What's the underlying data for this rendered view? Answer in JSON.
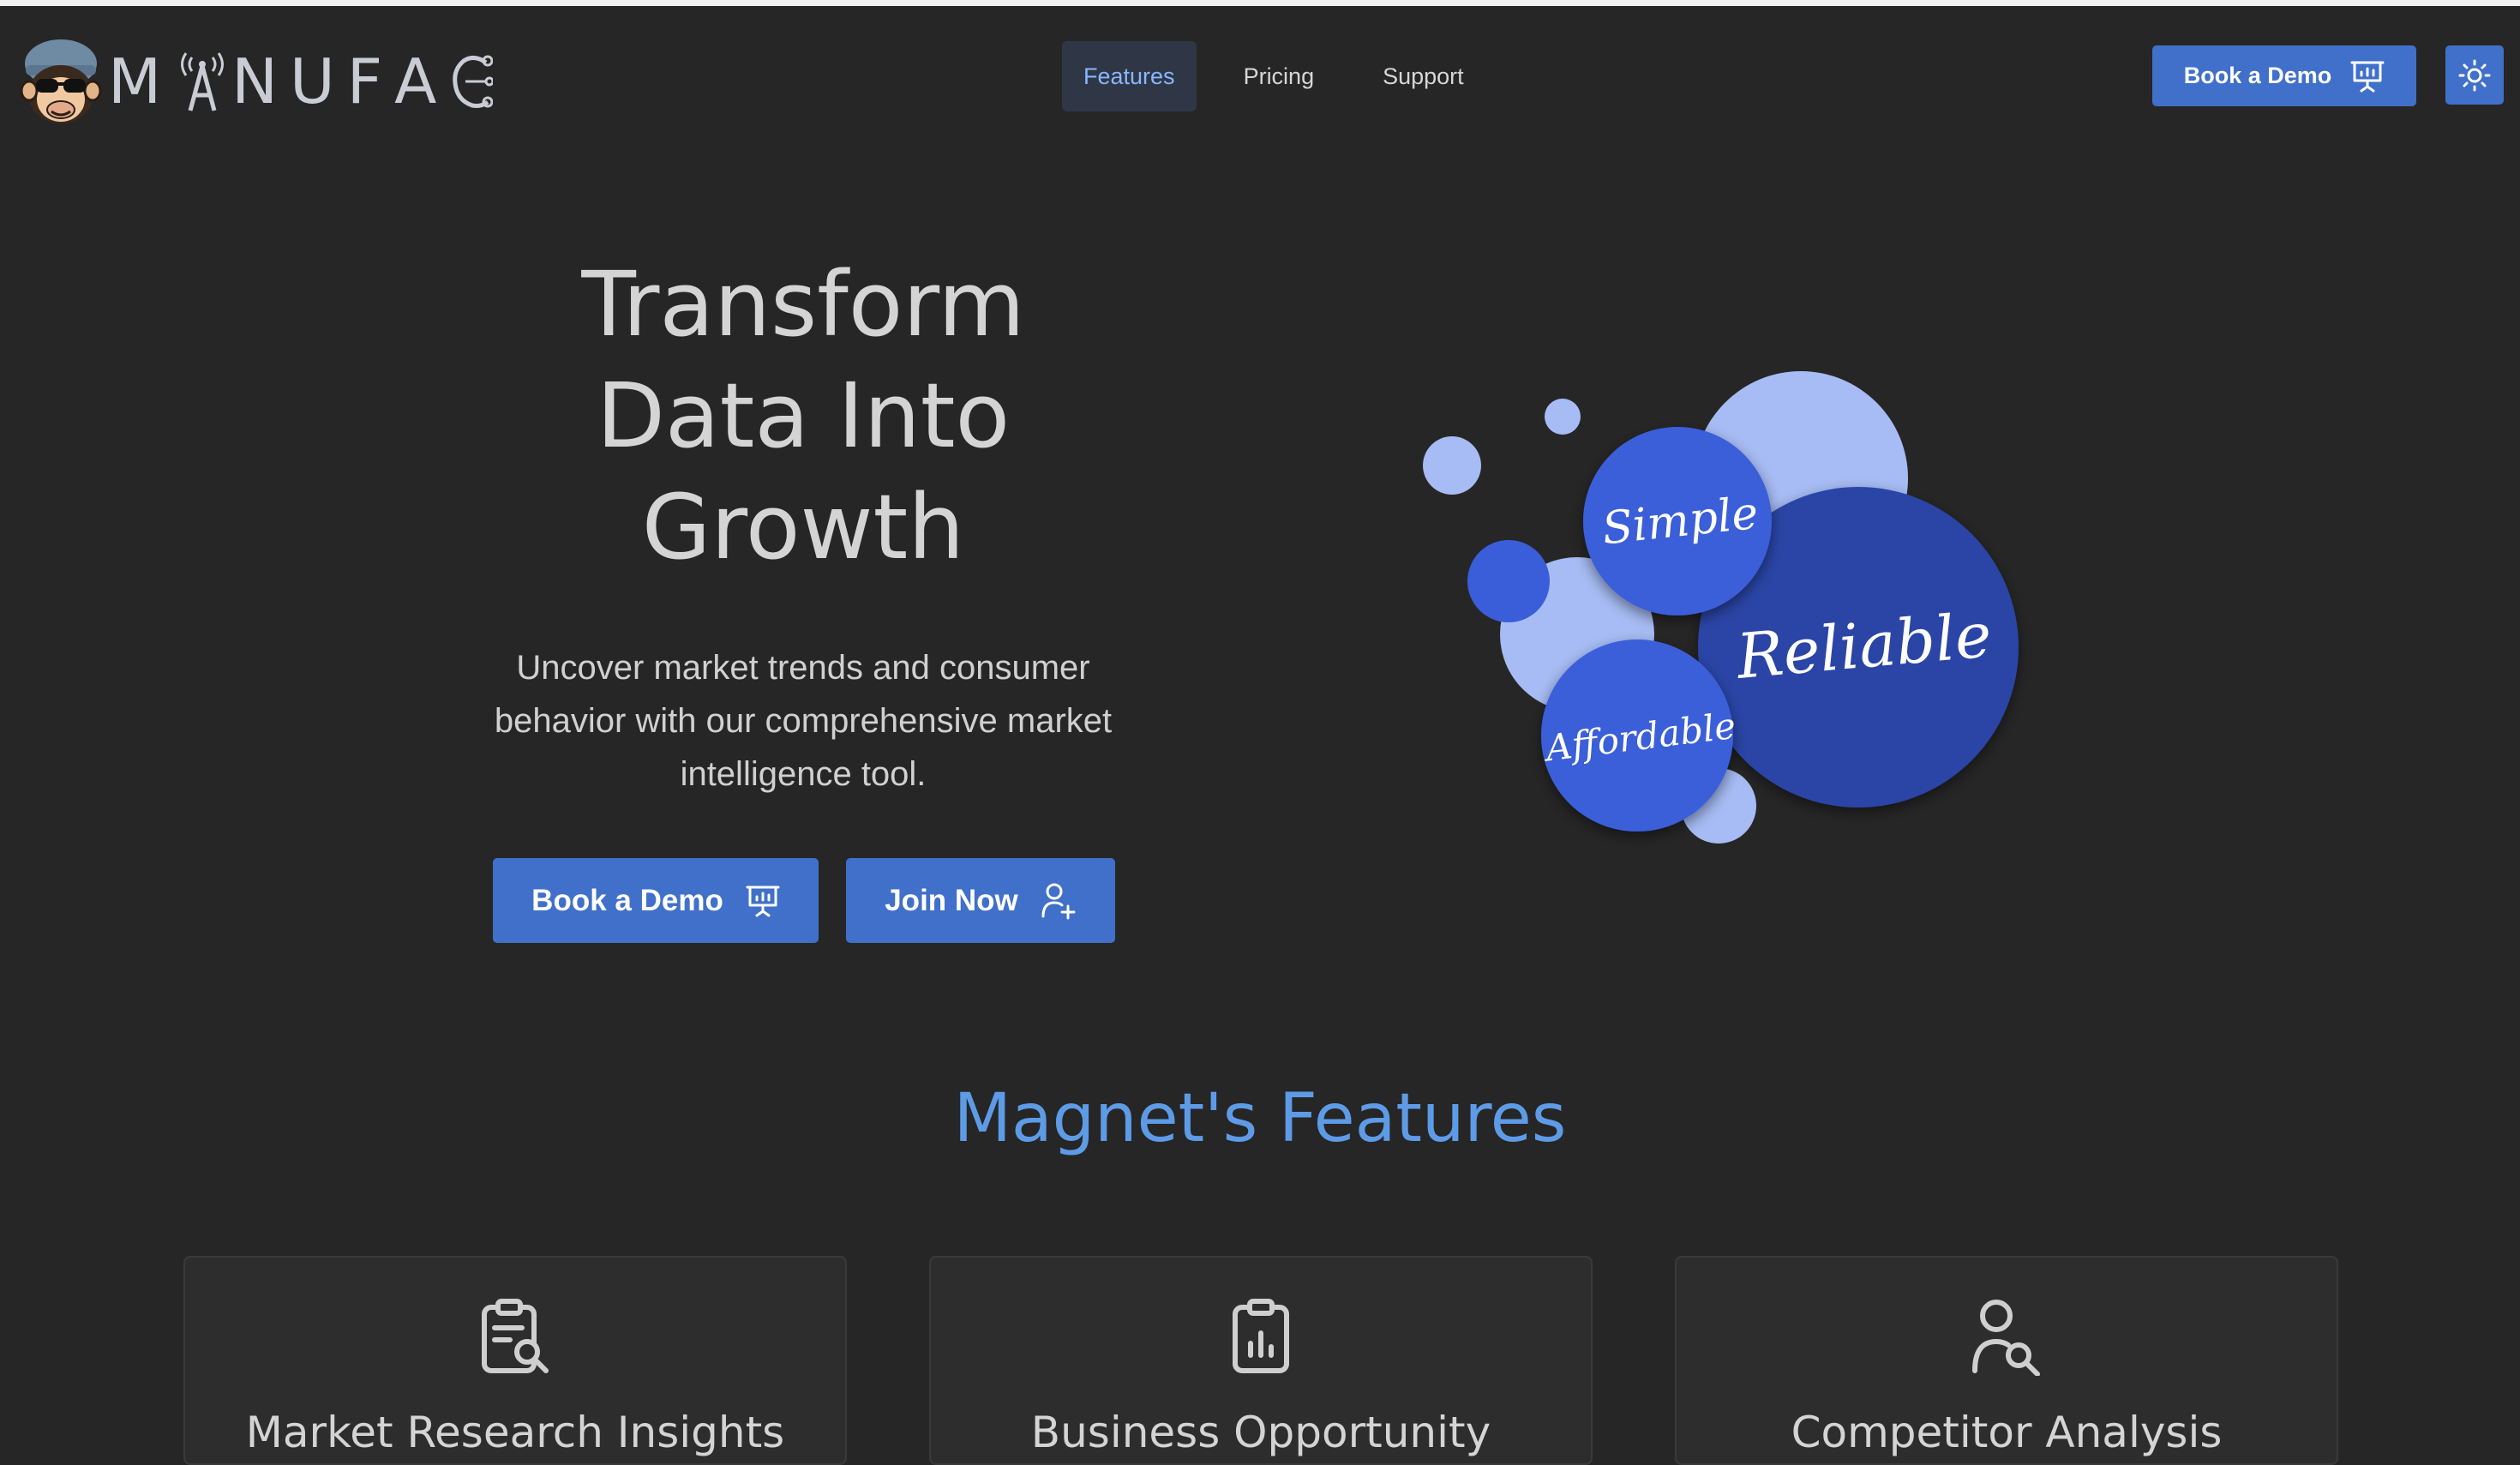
{
  "header": {
    "logo_text": "MANUFAC",
    "nav": [
      {
        "label": "Features",
        "active": true
      },
      {
        "label": "Pricing",
        "active": false
      },
      {
        "label": "Support",
        "active": false
      }
    ],
    "demo_button": "Book a Demo",
    "theme_toggle_icon": "sun-icon"
  },
  "hero": {
    "title_lines": [
      "Transform",
      "Data Into",
      "Growth"
    ],
    "subtitle_lines": [
      "Uncover market trends and consumer",
      "behavior with our comprehensive market",
      "intelligence tool."
    ],
    "demo_button": "Book a Demo",
    "join_button": "Join Now",
    "bubble_words": [
      "Simple",
      "Reliable",
      "Affordable"
    ]
  },
  "features": {
    "title": "Magnet's Features",
    "cards": [
      {
        "icon": "clipboard-search-icon",
        "title": "Market Research Insights"
      },
      {
        "icon": "clipboard-chart-icon",
        "title": "Business Opportunity"
      },
      {
        "icon": "user-search-icon",
        "title": "Competitor Analysis"
      }
    ]
  },
  "colors": {
    "background": "#262626",
    "accent_button": "#4070c9",
    "heading_blue": "#5e9be6",
    "nav_active_bg": "#2f3746",
    "bubble_light": "#a7bcf4",
    "bubble_mid": "#3a5ed9",
    "bubble_dark": "#2a44a6"
  }
}
